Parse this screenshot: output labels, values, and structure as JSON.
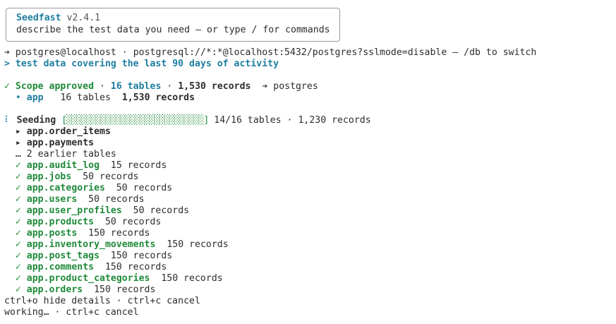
{
  "banner": {
    "app_name": "Seedfast",
    "version": "v2.4.1",
    "hint": "describe the test data you need — or type / for commands"
  },
  "connection": {
    "arrow": "➔",
    "user_host": "postgres@localhost",
    "sep": "·",
    "dsn": "postgresql://*:*@localhost:5432/postgres?sslmode=disable",
    "switch_hint": "— /db to switch"
  },
  "prompt": {
    "marker": ">",
    "text": "test data covering the last 90 days of activity"
  },
  "scope": {
    "check": "✓",
    "label": "Scope approved",
    "tables": "16 tables",
    "records": "1,530 records",
    "target_arrow": "➔",
    "target": "postgres",
    "schemas": [
      {
        "bullet": "•",
        "name": "app",
        "tables": "16 tables",
        "records": "1,530 records"
      }
    ]
  },
  "seeding": {
    "spinner": "⠇",
    "label": "Seeding",
    "bar": "[░░░░░░░░░░░░░░░░░░░░░░░░░░░░]",
    "progress_fraction": 0.875,
    "progress_text": "14/16 tables",
    "records": "1,230 records",
    "in_progress": [
      {
        "marker": "▸",
        "name": "app.order_items"
      },
      {
        "marker": "▸",
        "name": "app.payments"
      }
    ],
    "earlier": "… 2 earlier tables",
    "completed": [
      {
        "check": "✓",
        "name": "app.audit_log",
        "records": "15 records"
      },
      {
        "check": "✓",
        "name": "app.jobs",
        "records": "50 records"
      },
      {
        "check": "✓",
        "name": "app.categories",
        "records": "50 records"
      },
      {
        "check": "✓",
        "name": "app.users",
        "records": "50 records"
      },
      {
        "check": "✓",
        "name": "app.user_profiles",
        "records": "50 records"
      },
      {
        "check": "✓",
        "name": "app.products",
        "records": "50 records"
      },
      {
        "check": "✓",
        "name": "app.posts",
        "records": "150 records"
      },
      {
        "check": "✓",
        "name": "app.inventory_movements",
        "records": "150 records"
      },
      {
        "check": "✓",
        "name": "app.post_tags",
        "records": "150 records"
      },
      {
        "check": "✓",
        "name": "app.comments",
        "records": "150 records"
      },
      {
        "check": "✓",
        "name": "app.product_categories",
        "records": "150 records"
      },
      {
        "check": "✓",
        "name": "app.orders",
        "records": "150 records"
      }
    ]
  },
  "footer": {
    "details_hint": "ctrl+o hide details · ctrl+c cancel",
    "status": "working… · ctrl+c cancel"
  },
  "colors": {
    "accent": "#1f7ea0",
    "success": "#1f8a3a",
    "text": "#2d2d2d",
    "border": "#9a9a9a"
  }
}
